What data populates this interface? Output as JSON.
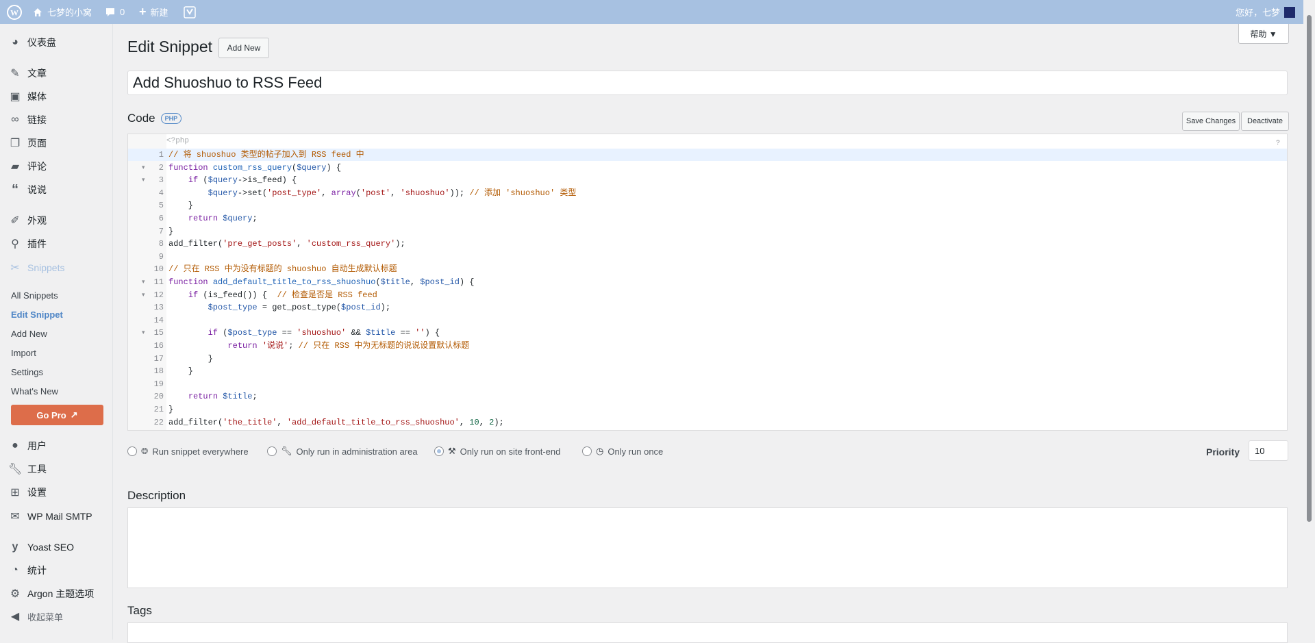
{
  "adminbar": {
    "site_name": "七梦的小窝",
    "comments_count": "0",
    "new_label": "新建",
    "greeting": "您好，七梦"
  },
  "help_button": "帮助 ▼",
  "sidebar": {
    "items": [
      {
        "label": "仪表盘",
        "icon": "dashboard-icon"
      },
      {
        "label": "文章",
        "icon": "pin-icon"
      },
      {
        "label": "媒体",
        "icon": "media-icon"
      },
      {
        "label": "链接",
        "icon": "link-icon"
      },
      {
        "label": "页面",
        "icon": "page-icon"
      },
      {
        "label": "评论",
        "icon": "comment-icon"
      },
      {
        "label": "说说",
        "icon": "quote-icon"
      },
      {
        "label": "外观",
        "icon": "brush-icon"
      },
      {
        "label": "插件",
        "icon": "plugin-icon"
      },
      {
        "label": "Snippets",
        "icon": "scissors-icon"
      }
    ],
    "submenu": [
      "All Snippets",
      "Edit Snippet",
      "Add New",
      "Import",
      "Settings",
      "What's New"
    ],
    "go_pro": "Go Pro",
    "bottom_items": [
      {
        "label": "用户",
        "icon": "user-icon"
      },
      {
        "label": "工具",
        "icon": "wrench-icon"
      },
      {
        "label": "设置",
        "icon": "settings-icon"
      },
      {
        "label": "WP Mail SMTP",
        "icon": "mail-icon"
      },
      {
        "label": "Yoast SEO",
        "icon": "yoast-icon"
      },
      {
        "label": "统计",
        "icon": "chart-icon"
      },
      {
        "label": "Argon 主题选项",
        "icon": "gear-icon"
      },
      {
        "label": "收起菜单",
        "icon": "collapse-icon"
      }
    ]
  },
  "main": {
    "page_title": "Edit Snippet",
    "add_new_button": "Add New",
    "snippet_title": "Add Shuoshuo to RSS Feed",
    "code_label": "Code",
    "php_badge": "PHP",
    "save_button": "Save Changes",
    "deactivate_button": "Deactivate",
    "php_open_tag": "<?php",
    "help_mark": "?",
    "code_lines": [
      {
        "n": "1",
        "text": "// 将 shuoshuo 类型的帖子加入到 RSS feed 中"
      },
      {
        "n": "2",
        "text": "function custom_rss_query($query) {"
      },
      {
        "n": "3",
        "text": "    if ($query->is_feed) {"
      },
      {
        "n": "4",
        "text": "        $query->set('post_type', array('post', 'shuoshuo')); // 添加 'shuoshuo' 类型"
      },
      {
        "n": "5",
        "text": "    }"
      },
      {
        "n": "6",
        "text": "    return $query;"
      },
      {
        "n": "7",
        "text": "}"
      },
      {
        "n": "8",
        "text": "add_filter('pre_get_posts', 'custom_rss_query');"
      },
      {
        "n": "9",
        "text": ""
      },
      {
        "n": "10",
        "text": "// 只在 RSS 中为没有标题的 shuoshuo 自动生成默认标题"
      },
      {
        "n": "11",
        "text": "function add_default_title_to_rss_shuoshuo($title, $post_id) {"
      },
      {
        "n": "12",
        "text": "    if (is_feed()) {  // 检查是否是 RSS feed"
      },
      {
        "n": "13",
        "text": "        $post_type = get_post_type($post_id);"
      },
      {
        "n": "14",
        "text": ""
      },
      {
        "n": "15",
        "text": "        if ($post_type == 'shuoshuo' && $title == '') {"
      },
      {
        "n": "16",
        "text": "            return '说说'; // 只在 RSS 中为无标题的说说设置默认标题"
      },
      {
        "n": "17",
        "text": "        }"
      },
      {
        "n": "18",
        "text": "    }"
      },
      {
        "n": "19",
        "text": ""
      },
      {
        "n": "20",
        "text": "    return $title;"
      },
      {
        "n": "21",
        "text": "}"
      },
      {
        "n": "22",
        "text": "add_filter('the_title', 'add_default_title_to_rss_shuoshuo', 10, 2);"
      }
    ],
    "run_options": [
      {
        "label": "Run snippet everywhere",
        "icon": "globe-icon",
        "checked": false
      },
      {
        "label": "Only run in administration area",
        "icon": "wrench-icon",
        "checked": false
      },
      {
        "label": "Only run on site front-end",
        "icon": "hammer-icon",
        "checked": true
      },
      {
        "label": "Only run once",
        "icon": "clock-icon",
        "checked": false
      }
    ],
    "priority_label": "Priority",
    "priority_value": "10",
    "description_heading": "Description",
    "tags_heading": "Tags"
  },
  "colors": {
    "adminbar": "#a7c1e1",
    "accent": "#4f86c6",
    "go_pro": "#dd6d4a"
  }
}
